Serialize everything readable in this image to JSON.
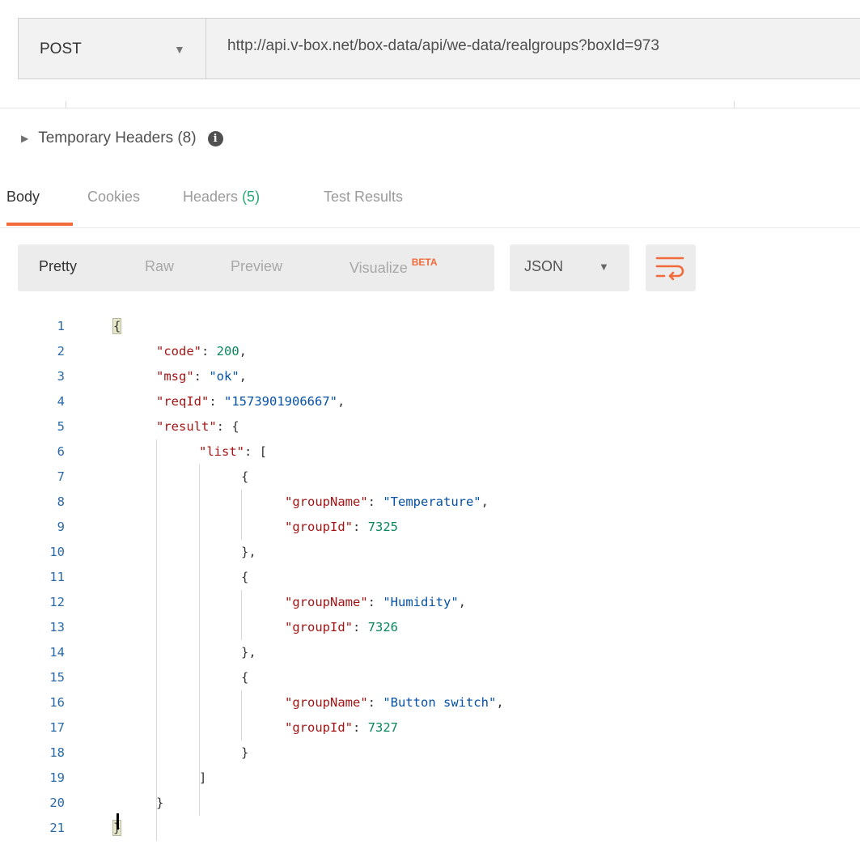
{
  "request": {
    "method": "POST",
    "url": "http://api.v-box.net/box-data/api/we-data/realgroups?boxId=973"
  },
  "temporary_headers": {
    "label": "Temporary Headers (8)"
  },
  "response_tabs": [
    {
      "label": "Body",
      "active": true
    },
    {
      "label": "Cookies"
    },
    {
      "label": "Headers",
      "count": "(5)"
    },
    {
      "label": "Test Results"
    }
  ],
  "view_tabs": {
    "pretty": "Pretty",
    "raw": "Raw",
    "preview": "Preview",
    "visualize": "Visualize",
    "beta": "BETA"
  },
  "format": {
    "selected": "JSON"
  },
  "code_lines": [
    {
      "n": "1",
      "text": "{"
    },
    {
      "n": "2",
      "text": "\"code\": 200,"
    },
    {
      "n": "3",
      "text": "\"msg\": \"ok\","
    },
    {
      "n": "4",
      "text": "\"reqId\": \"1573901906667\","
    },
    {
      "n": "5",
      "text": "\"result\": {"
    },
    {
      "n": "6",
      "text": "\"list\": ["
    },
    {
      "n": "7",
      "text": "{"
    },
    {
      "n": "8",
      "text": "\"groupName\": \"Temperature\","
    },
    {
      "n": "9",
      "text": "\"groupId\": 7325"
    },
    {
      "n": "10",
      "text": "},"
    },
    {
      "n": "11",
      "text": "{"
    },
    {
      "n": "12",
      "text": "\"groupName\": \"Humidity\","
    },
    {
      "n": "13",
      "text": "\"groupId\": 7326"
    },
    {
      "n": "14",
      "text": "},"
    },
    {
      "n": "15",
      "text": "{"
    },
    {
      "n": "16",
      "text": "\"groupName\": \"Button switch\","
    },
    {
      "n": "17",
      "text": "\"groupId\": 7327"
    },
    {
      "n": "18",
      "text": "}"
    },
    {
      "n": "19",
      "text": "]"
    },
    {
      "n": "20",
      "text": "}"
    },
    {
      "n": "21",
      "text": "}"
    }
  ],
  "colors": {
    "accent": "#f26b3a",
    "count": "#2aa876",
    "line_number": "#2a6aa8"
  }
}
